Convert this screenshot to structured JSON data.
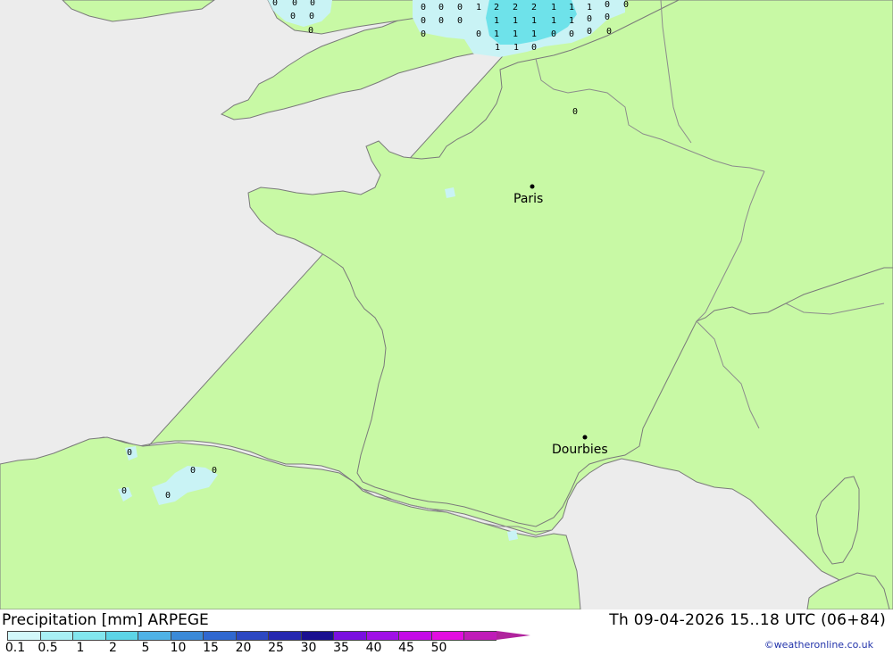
{
  "map": {
    "colors": {
      "sea": "#ececec",
      "land": "#c8f9a5",
      "border": "#8c8c8c",
      "coast": "#7a7a7a",
      "precip_light": "#c9f3f5",
      "precip_mid": "#6ee2ea"
    },
    "cities": [
      {
        "name": "Paris"
      },
      {
        "name": "Dourbies"
      }
    ],
    "grid_values": [
      "0",
      "0",
      "0",
      "0",
      "0",
      "0",
      "0",
      "0",
      "0",
      "1",
      "2",
      "2",
      "2",
      "1",
      "1",
      "1",
      "0",
      "0",
      "0",
      "0",
      "0",
      "1",
      "1",
      "1",
      "1",
      "1",
      "0",
      "0",
      "0",
      "0",
      "1",
      "1",
      "1",
      "0",
      "0",
      "0",
      "0",
      "1",
      "1",
      "0",
      "0",
      "0",
      "0",
      "0",
      "0",
      "0"
    ]
  },
  "footer": {
    "title": "Precipitation [mm] ARPEGE",
    "valid": "Th 09-04-2026 15..18 UTC (06+84)",
    "credit": "©weatheronline.co.uk",
    "scale_colors": [
      "#d2f8fa",
      "#a8eff4",
      "#82e6ee",
      "#5cd4e6",
      "#4fb2e6",
      "#3b8ad8",
      "#3068d0",
      "#2c48c2",
      "#2628b0",
      "#1a1090",
      "#7a10e0",
      "#a010e6",
      "#c40ae6",
      "#e20ee0",
      "#c01cb8"
    ],
    "scale_labels": [
      "0.1",
      "0.5",
      "1",
      "2",
      "5",
      "10",
      "15",
      "20",
      "25",
      "30",
      "35",
      "40",
      "45",
      "50"
    ]
  }
}
